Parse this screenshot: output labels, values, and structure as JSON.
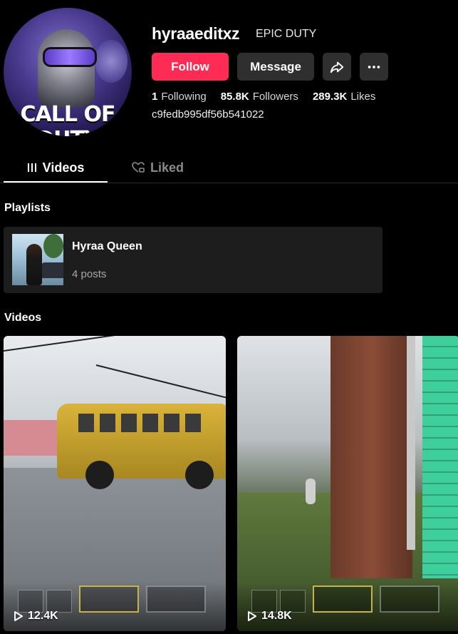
{
  "profile": {
    "username": "hyraaeditxz",
    "nickname": "EPIC DUTY",
    "avatar_text": "CALL OF DUTY",
    "bio": "c9fedb995df56b541022"
  },
  "actions": {
    "follow_label": "Follow",
    "message_label": "Message",
    "share_icon": "share-icon",
    "more_icon": "more-horizontal-icon",
    "follow_color": "#fe2c55"
  },
  "stats": {
    "following_count": "1",
    "following_label": "Following",
    "followers_count": "85.8K",
    "followers_label": "Followers",
    "likes_count": "289.3K",
    "likes_label": "Likes"
  },
  "tabs": [
    {
      "label": "Videos",
      "icon": "grid-icon",
      "active": true
    },
    {
      "label": "Liked",
      "icon": "heart-lock-icon",
      "active": false
    }
  ],
  "playlists": {
    "title": "Playlists",
    "items": [
      {
        "name": "Hyraa Queen",
        "count": "4 posts"
      }
    ]
  },
  "videos": {
    "title": "Videos",
    "items": [
      {
        "views": "12.4K",
        "icon": "play-icon"
      },
      {
        "views": "14.8K",
        "icon": "play-icon"
      }
    ]
  }
}
